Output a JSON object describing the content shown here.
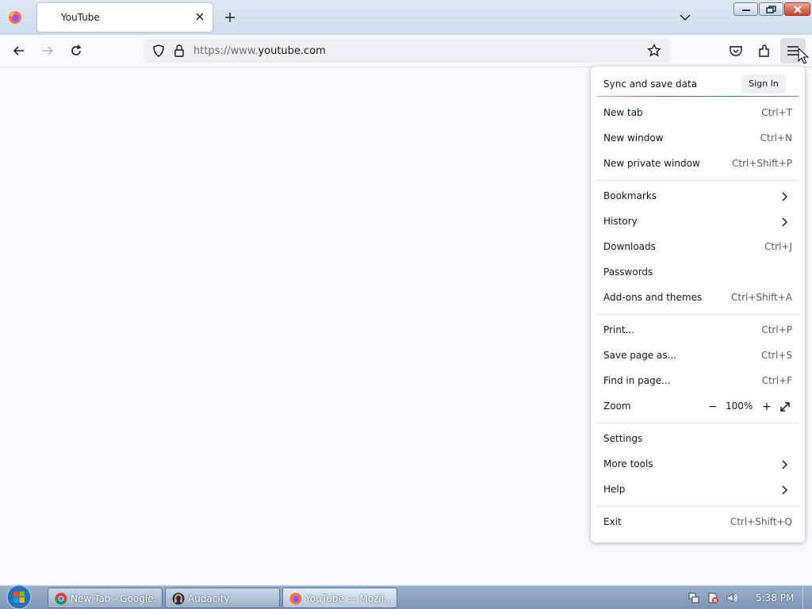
{
  "browser": {
    "tab": {
      "title": "YouTube"
    },
    "url": {
      "prefix": "https://www.",
      "domain": "youtube.com"
    }
  },
  "menu": {
    "sync_label": "Sync and save data",
    "sign_in": "Sign In",
    "items": [
      {
        "label": "New tab",
        "shortcut": "Ctrl+T"
      },
      {
        "label": "New window",
        "shortcut": "Ctrl+N"
      },
      {
        "label": "New private window",
        "shortcut": "Ctrl+Shift+P"
      },
      {
        "label": "Bookmarks"
      },
      {
        "label": "History"
      },
      {
        "label": "Downloads",
        "shortcut": "Ctrl+J"
      },
      {
        "label": "Passwords"
      },
      {
        "label": "Add-ons and themes",
        "shortcut": "Ctrl+Shift+A"
      },
      {
        "label": "Print...",
        "shortcut": "Ctrl+P"
      },
      {
        "label": "Save page as...",
        "shortcut": "Ctrl+S"
      },
      {
        "label": "Find in page...",
        "shortcut": "Ctrl+F"
      },
      {
        "label": "Zoom"
      },
      {
        "label": "Settings"
      },
      {
        "label": "More tools"
      },
      {
        "label": "Help"
      },
      {
        "label": "Exit",
        "shortcut": "Ctrl+Shift+Q"
      }
    ],
    "zoom": {
      "minus": "−",
      "value": "100%",
      "plus": "+"
    }
  },
  "taskbar": {
    "tasks": [
      {
        "label": "New Tab - Google...",
        "icon": "chrome-icon"
      },
      {
        "label": "Audacity",
        "icon": "audacity-icon"
      },
      {
        "label": "YouTube — Mozil...",
        "icon": "firefox-icon"
      }
    ],
    "clock": "5:38 PM"
  },
  "colors": {
    "accent": "#0061e0",
    "taskbar": "#8aa2c0",
    "menu_bg": "#ffffff"
  }
}
